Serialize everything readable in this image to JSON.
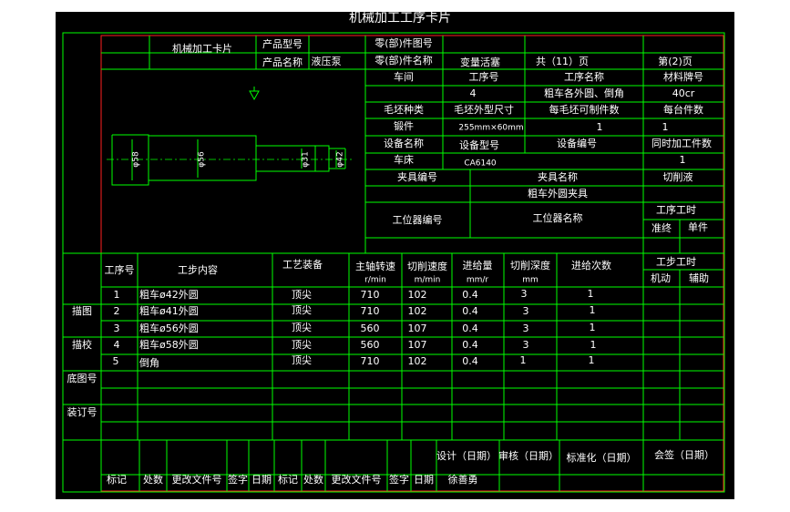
{
  "title": "机械加工工序卡片",
  "header": {
    "card_name": "机械加工卡片",
    "product_model_label": "产品型号",
    "product_name_label": "产品名称",
    "product_name": "液压泵",
    "part_drawing_label": "零(部)件图号",
    "part_name_label": "零(部)件名称",
    "part_name": "变量活塞",
    "total_pages": "共（11）页",
    "page_no": "第(2)页"
  },
  "info": {
    "workshop_label": "车间",
    "op_no_label": "工序号",
    "op_name_label": "工序名称",
    "material_label": "材料牌号",
    "op_no": "4",
    "op_name": "粗车各外圆、倒角",
    "material": "40cr",
    "blank_type_label": "毛坯种类",
    "blank_size_label": "毛坯外型尺寸",
    "pieces_per_blank_label": "每毛坯可制件数",
    "pieces_per_unit_label": "每台件数",
    "blank_type": "锻件",
    "blank_size": "255mm×60mm",
    "pieces_per_blank": "1",
    "pieces_per_unit": "1",
    "equip_name_label": "设备名称",
    "equip_model_label": "设备型号",
    "equip_no_label": "设备编号",
    "simul_label": "同时加工件数",
    "equip_name": "车床",
    "equip_model": "CA6140",
    "simul": "1",
    "fixture_no_label": "夹具编号",
    "fixture_name_label": "夹具名称",
    "coolant_label": "切削液",
    "fixture_name": "粗车外圆夹具",
    "station_no_label": "工位器编号",
    "station_name_label": "工位器名称",
    "op_time_label": "工序工时",
    "prep_label": "准终",
    "unit_label": "单件"
  },
  "drawing": {
    "dims": [
      "φ58",
      "φ56",
      "φ31",
      "φ42"
    ]
  },
  "steps_header": {
    "step_no": "工序号",
    "content": "工步内容",
    "equipment": "工艺装备",
    "speed": "主轴转速",
    "speed_unit": "r/min",
    "cut_speed": "切削速度",
    "cut_speed_unit": "m/min",
    "feed": "进给量",
    "feed_unit": "mm/r",
    "depth": "切削深度",
    "depth_unit": "mm",
    "passes": "进给次数",
    "step_time": "工步工时",
    "machine": "机动",
    "aux": "辅助"
  },
  "steps": [
    {
      "no": "1",
      "content": "粗车ø42外圆",
      "equip": "顶尖",
      "speed": "710",
      "cut": "102",
      "feed": "0.4",
      "depth": "3",
      "passes": "1"
    },
    {
      "no": "2",
      "content": "粗车ø41外圆",
      "equip": "顶尖",
      "speed": "710",
      "cut": "102",
      "feed": "0.4",
      "depth": "3",
      "passes": "1"
    },
    {
      "no": "3",
      "content": "粗车ø56外圆",
      "equip": "顶尖",
      "speed": "560",
      "cut": "107",
      "feed": "0.4",
      "depth": "3",
      "passes": "1"
    },
    {
      "no": "4",
      "content": "粗车ø58外圆",
      "equip": "顶尖",
      "speed": "560",
      "cut": "107",
      "feed": "0.4",
      "depth": "3",
      "passes": "1"
    },
    {
      "no": "5",
      "content": "倒角",
      "equip": "顶尖",
      "speed": "710",
      "cut": "102",
      "feed": "0.4",
      "depth": "1",
      "passes": "1"
    }
  ],
  "side": {
    "trace": "描图",
    "check": "描校",
    "base_no": "底图号",
    "binding_no": "装订号"
  },
  "footer": {
    "design": "设计（日期）",
    "review": "审核（日期）",
    "standard": "标准化（日期）",
    "sign": "会签（日期）",
    "mark": "标记",
    "count": "处数",
    "change_doc": "更改文件号",
    "signature": "签字",
    "date": "日期",
    "designer": "徐善勇"
  },
  "colors": {
    "background": "#000000",
    "frame": "#00ff00",
    "inner_border": "#ff2020",
    "text": "#ffffff"
  }
}
